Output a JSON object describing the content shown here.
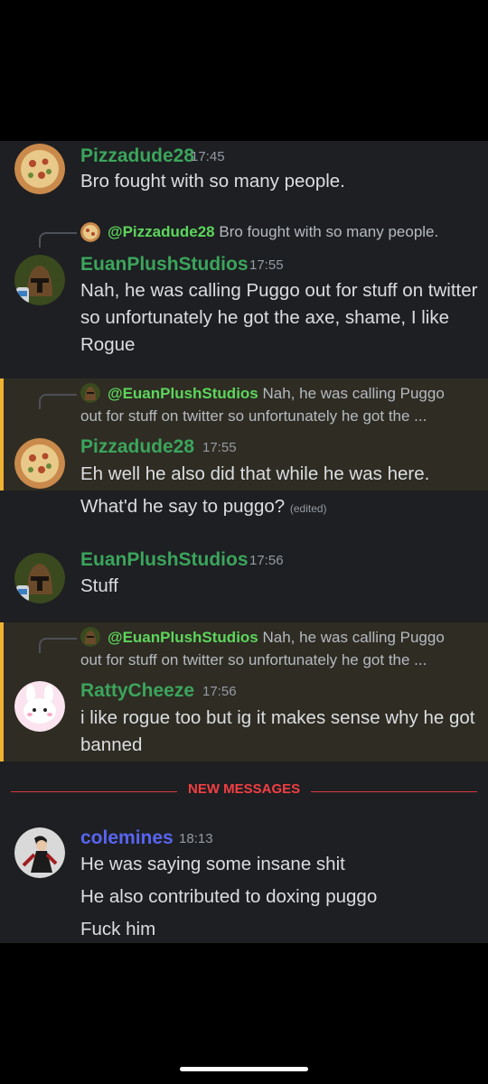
{
  "colors": {
    "green_name": "#3ba55c",
    "purple_name": "#5865f2",
    "new_messages": "#f23f43",
    "highlight_bar": "#f0b232"
  },
  "messages": [
    {
      "author": "Pizzadude28",
      "time": "17:45",
      "lines": [
        "Bro fought with so many people."
      ]
    },
    {
      "reply": {
        "mention": "@Pizzadude28",
        "text": "Bro fought with so many people."
      },
      "author": "EuanPlushStudios",
      "time": "17:55",
      "text": "Nah, he was calling Puggo out for stuff on twitter so unfortunately he got the axe, shame, I like Rogue"
    },
    {
      "reply": {
        "mention": "@EuanPlushStudios",
        "text_first": "Nah, he was calling Puggo",
        "text_second": "out for stuff on twitter so unfortunately he got the ..."
      },
      "author": "Pizzadude28",
      "time": "17:55",
      "line1": "Eh well he also did that while he was here.",
      "line2": "What'd he say to puggo?",
      "edited": "(edited)"
    },
    {
      "author": "EuanPlushStudios",
      "time": "17:56",
      "text": "Stuff"
    },
    {
      "reply": {
        "mention": "@EuanPlushStudios",
        "text_first": "Nah, he was calling Puggo",
        "text_second": "out for stuff on twitter so unfortunately he got the ..."
      },
      "author": "RattyCheeze",
      "time": "17:56",
      "text": "i like rogue too but ig it makes sense why he got banned"
    },
    {
      "author": "colemines",
      "time": "18:13",
      "line1": "He was saying some insane shit",
      "line2": "He also contributed to doxing puggo",
      "line3": "Fuck him"
    }
  ],
  "divider": {
    "label": "NEW MESSAGES"
  }
}
